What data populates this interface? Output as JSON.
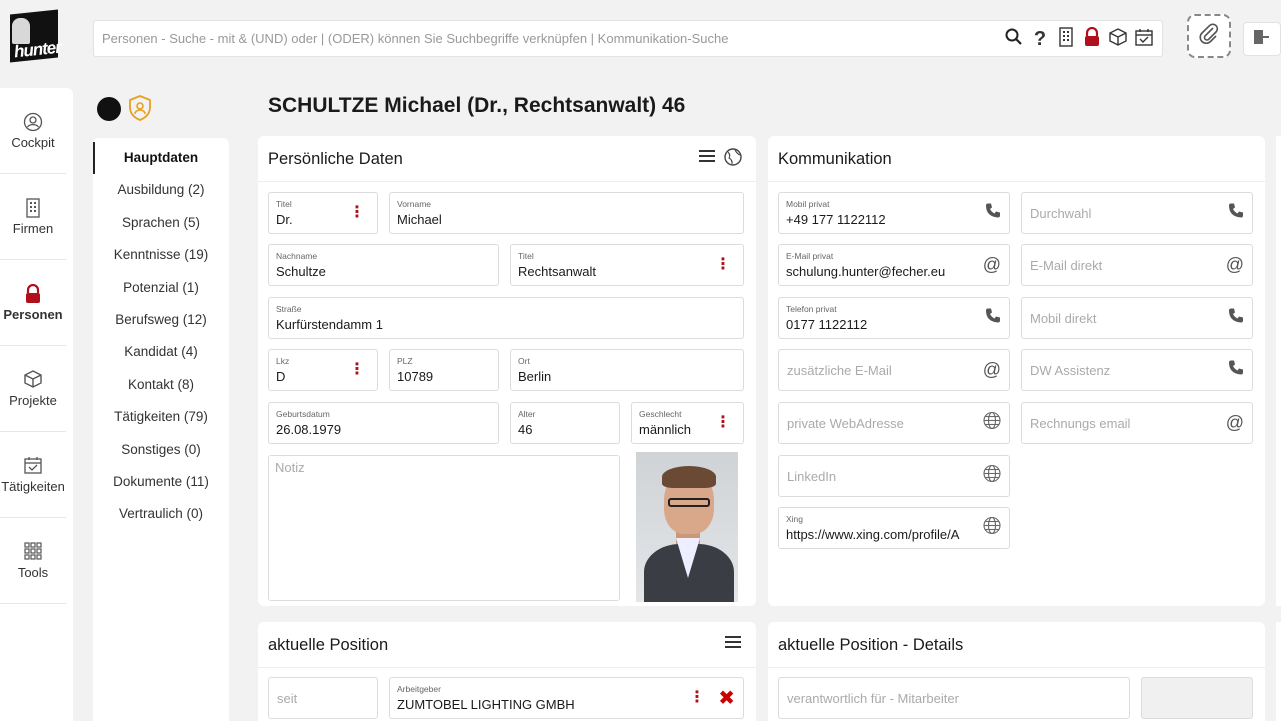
{
  "app": {
    "logo_text": "hunter"
  },
  "search": {
    "placeholder": "Personen - Suche - mit & (UND) oder | (ODER) können Sie Suchbegriffe verknüpfen | Kommunikation-Suche"
  },
  "toolbar_icons": [
    "search-icon",
    "help-icon",
    "building-icon",
    "lock-icon",
    "box-icon",
    "calendar-check-icon",
    "paperclip-icon",
    "exit-icon"
  ],
  "nav": {
    "items": [
      {
        "label": "Cockpit",
        "icon": "cockpit-icon"
      },
      {
        "label": "Firmen",
        "icon": "building-icon"
      },
      {
        "label": "Personen",
        "icon": "person-icon"
      },
      {
        "label": "Projekte",
        "icon": "box-icon"
      },
      {
        "label": "Tätigkeiten",
        "icon": "calendar-check-icon"
      },
      {
        "label": "Tools",
        "icon": "grid-icon"
      }
    ],
    "active": "Personen"
  },
  "subnav": {
    "items": [
      "Hauptdaten",
      "Ausbildung (2)",
      "Sprachen (5)",
      "Kenntnisse (19)",
      "Potenzial (1)",
      "Berufsweg (12)",
      "Kandidat (4)",
      "Kontakt (8)",
      "Tätigkeiten (79)",
      "Sonstiges (0)",
      "Dokumente (11)",
      "Vertraulich (0)"
    ],
    "active": "Hauptdaten"
  },
  "page": {
    "title": "SCHULTZE Michael (Dr., Rechtsanwalt) 46"
  },
  "personal": {
    "title": "Persönliche Daten",
    "titel1": {
      "label": "Titel",
      "value": "Dr."
    },
    "vorname": {
      "label": "Vorname",
      "value": "Michael"
    },
    "nachname": {
      "label": "Nachname",
      "value": "Schultze"
    },
    "titel2": {
      "label": "Titel",
      "value": "Rechtsanwalt"
    },
    "strasse": {
      "label": "Straße",
      "value": "Kurfürstendamm 1"
    },
    "lkz": {
      "label": "Lkz",
      "value": "D"
    },
    "plz": {
      "label": "PLZ",
      "value": "10789"
    },
    "ort": {
      "label": "Ort",
      "value": "Berlin"
    },
    "geburtsdatum": {
      "label": "Geburtsdatum",
      "value": "26.08.1979"
    },
    "alter": {
      "label": "Alter",
      "value": "46"
    },
    "geschlecht": {
      "label": "Geschlecht",
      "value": "männlich"
    },
    "notiz_placeholder": "Notiz"
  },
  "komm": {
    "title": "Kommunikation",
    "mobil_privat": {
      "label": "Mobil privat",
      "value": "+49 177 1122112"
    },
    "durchwahl": "Durchwahl",
    "email_privat": {
      "label": "E-Mail privat",
      "value": "schulung.hunter@fecher.eu"
    },
    "email_direkt": "E-Mail direkt",
    "telefon_privat": {
      "label": "Telefon privat",
      "value": "0177 1122112"
    },
    "mobil_direkt": "Mobil direkt",
    "zus_email": "zusätzliche E-Mail",
    "dw_assistenz": "DW Assistenz",
    "private_web": "private WebAdresse",
    "rechnungs_email": "Rechnungs email",
    "linkedin": "LinkedIn",
    "xing": {
      "label": "Xing",
      "value": "https://www.xing.com/profile/A"
    }
  },
  "position": {
    "title": "aktuelle Position",
    "seit": "seit",
    "arbeitgeber": {
      "label": "Arbeitgeber",
      "value": "ZUMTOBEL LIGHTING GMBH"
    }
  },
  "position_details": {
    "title": "aktuelle Position - Details",
    "verantwortlich": "verantwortlich für - Mitarbeiter"
  }
}
